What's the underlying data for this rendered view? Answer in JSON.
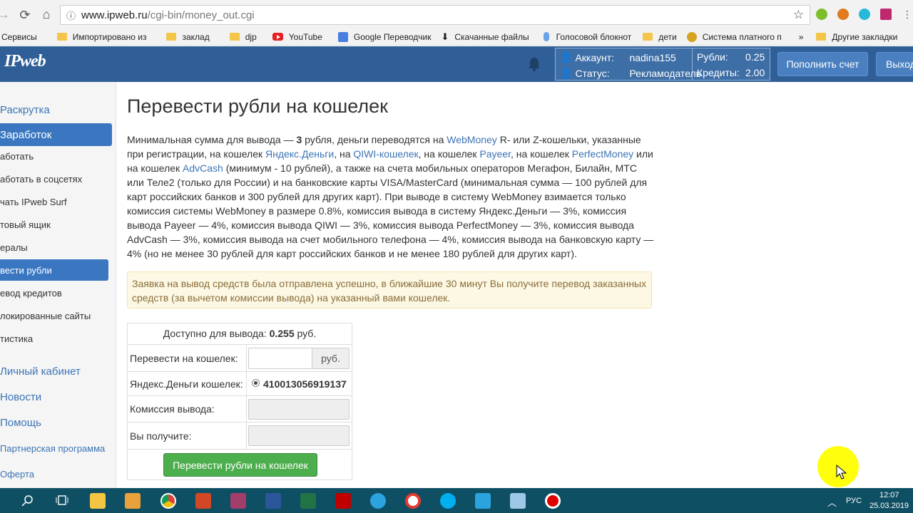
{
  "browser": {
    "url_host": "www.ipweb.ru",
    "url_path": "/cgi-bin/money_out.cgi",
    "bookmarks": [
      "Сервисы",
      "Импортировано из",
      "заклад",
      "djp",
      "YouTube",
      "Google Переводчик",
      "Скачанные файлы",
      "Голосовой блокнот",
      "дети",
      "Система платного п",
      "»",
      "Другие закладки"
    ]
  },
  "header": {
    "logo": "IPweb",
    "account_label": "Аккаунт:",
    "account_value": "nadina155",
    "status_label": "Статус:",
    "status_value": "Рекламодатель",
    "rubles_label": "Рубли:",
    "rubles_value": "0.25",
    "credits_label": "Кредиты:",
    "credits_value": "2.00",
    "topup_button": "Пополнить счет",
    "logout_button": "Выход"
  },
  "sidebar": {
    "sections": [
      "Раскрутка",
      "Заработок",
      "Личный кабинет",
      "Новости",
      "Помощь",
      "Партнерская программа",
      "Оферта"
    ],
    "sub_items": [
      "аботать",
      "аботать в соцсетях",
      "чать IPweb Surf",
      "товый ящик",
      "ералы",
      "вести рубли",
      "евод кредитов",
      "локированные сайты",
      "тистика"
    ]
  },
  "main": {
    "title": "Перевести рубли на кошелек",
    "desc_1": "Минимальная сумма для вывода — ",
    "desc_min": "3",
    "desc_2": " рубля, деньги переводятся на ",
    "link_webmoney": "WebMoney",
    "desc_3": " R- или Z-кошельки, указанные при регистрации, на кошелек ",
    "link_yandex": "Яндекс.Деньги",
    "desc_4": ", на ",
    "link_qiwi": "QIWI-кошелек",
    "desc_5": ", на кошелек ",
    "link_payeer": "Payeer",
    "desc_6": ", на кошелек ",
    "link_perfect": "PerfectMoney",
    "desc_7": " или на кошелек ",
    "link_advcash": "AdvCash",
    "desc_8": " (минимум - 10 рублей), а также на счета мобильных операторов Мегафон, Билайн, МТС или Теле2 (только для России) и на банковские карты VISA/MasterCard (минимальная сумма — 100 рублей для карт российских банков и 300 рублей для других карт). При выводе в систему WebMoney взимается только комиссия системы WebMoney в размере 0.8%, комиссия вывода в систему Яндекс.Деньги — 3%, комиссия вывода Payeer — 4%, комиссия вывода QIWI — 3%, комиссия вывода PerfectMoney — 3%, комиссия вывода AdvCash — 3%, комиссия вывода на счет мобильного телефона — 4%, комиссия вывода на банковскую карту — 4% (но не менее 30 рублей для карт российских банков и не менее 180 рублей для других карт).",
    "alert": "Заявка на вывод средств была отправлена успешно, в ближайшие 30 минут Вы получите перевод заказанных средств (за вычетом комиссии вывода) на указанный вами кошелек."
  },
  "form": {
    "available_label": "Доступно для вывода: ",
    "available_value": "0.255",
    "available_unit": " руб.",
    "transfer_label": "Перевести на кошелек:",
    "transfer_value": "",
    "currency_addon": "руб.",
    "wallet_label": "Яндекс.Деньги кошелек:",
    "wallet_value": "410013056919137",
    "commission_label": "Комиссия вывода:",
    "receive_label": "Вы получите:",
    "submit": "Перевести рубли на кошелек"
  },
  "taskbar": {
    "lang": "РУС",
    "time": "12:07",
    "date": "25.03.2019"
  }
}
